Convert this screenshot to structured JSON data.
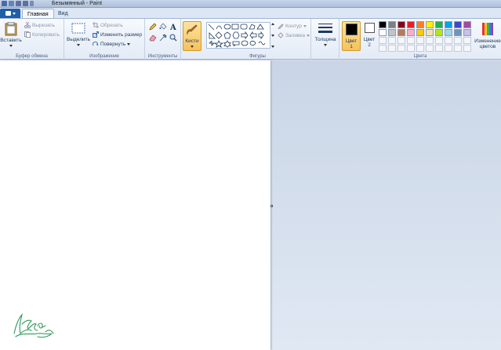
{
  "window": {
    "title": "Безымянный - Paint"
  },
  "tabs": [
    {
      "label": "Главная"
    },
    {
      "label": "Вид"
    }
  ],
  "clipboard": {
    "group_label": "Буфер обмена",
    "paste": "Вставить",
    "cut": "Вырезать",
    "copy": "Копировать"
  },
  "image": {
    "group_label": "Изображение",
    "select": "Выделить",
    "crop": "Обрезать",
    "resize": "Изменить размер",
    "rotate": "Повернуть"
  },
  "tools": {
    "group_label": "Инструменты"
  },
  "brushes": {
    "label": "Кисти"
  },
  "shapes": {
    "group_label": "Фигуры",
    "outline": "Контур",
    "fill": "Заливка"
  },
  "size": {
    "label": "Толщина"
  },
  "colors": {
    "group_label": "Цвета",
    "color1": "Цвет",
    "color1_num": "1",
    "color2": "Цвет",
    "color2_num": "2",
    "edit_colors_line1": "Изменение",
    "edit_colors_line2": "цветов",
    "color1_value": "#000000",
    "color2_value": "#ffffff",
    "palette_row1": [
      "#000000",
      "#7f7f7f",
      "#880015",
      "#ed1c24",
      "#ff7f27",
      "#fff200",
      "#22b14c",
      "#00a2e8",
      "#3f48cc",
      "#a349a4"
    ],
    "palette_row2": [
      "#ffffff",
      "#c3c3c3",
      "#b97a57",
      "#ffaec9",
      "#ffc90e",
      "#efe4b0",
      "#b5e61d",
      "#99d9ea",
      "#7092be",
      "#c8bfe7"
    ]
  },
  "icons": [
    "paste-icon",
    "cut-icon",
    "copy-icon",
    "select-icon",
    "crop-icon",
    "resize-icon",
    "rotate-icon",
    "pencil-icon",
    "fill-icon",
    "text-icon",
    "eraser-icon",
    "color-picker-icon",
    "magnifier-icon",
    "brush-icon",
    "size-icon",
    "edit-colors-icon"
  ]
}
